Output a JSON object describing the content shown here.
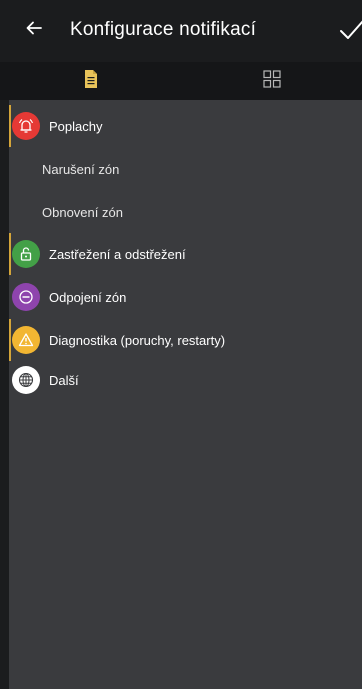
{
  "header": {
    "title": "Konfigurace notifikací",
    "back_icon": "arrow-left-icon",
    "confirm_icon": "checkmark-icon"
  },
  "tabs": [
    {
      "icon": "document-icon",
      "active": true,
      "color": "#e8c35a"
    },
    {
      "icon": "grid-icon",
      "active": false,
      "color": "#b8b8b8"
    }
  ],
  "groups": [
    {
      "label": "Poplachy",
      "icon": "alarm-bell-icon",
      "color": "#e53935",
      "accent": true
    },
    {
      "label": "Narušení zón",
      "sub": true
    },
    {
      "label": "Obnovení zón",
      "sub": true
    },
    {
      "label": "Zastřežení a odstřežení",
      "icon": "lock-icon",
      "color": "#43a047",
      "accent": true
    },
    {
      "label": "Odpojení zón",
      "icon": "minus-circle-icon",
      "color": "#8e44ad",
      "accent": false
    },
    {
      "label": "Diagnostika (poruchy, restarty)",
      "icon": "warning-icon",
      "color": "#f2b632",
      "accent": true
    },
    {
      "label": "Další",
      "icon": "globe-icon",
      "color": "#ffffff",
      "accent": false
    }
  ],
  "colors": {
    "background": "#1b1c1e",
    "panel": "#3a3b3e",
    "accent": "#d4a53a"
  }
}
